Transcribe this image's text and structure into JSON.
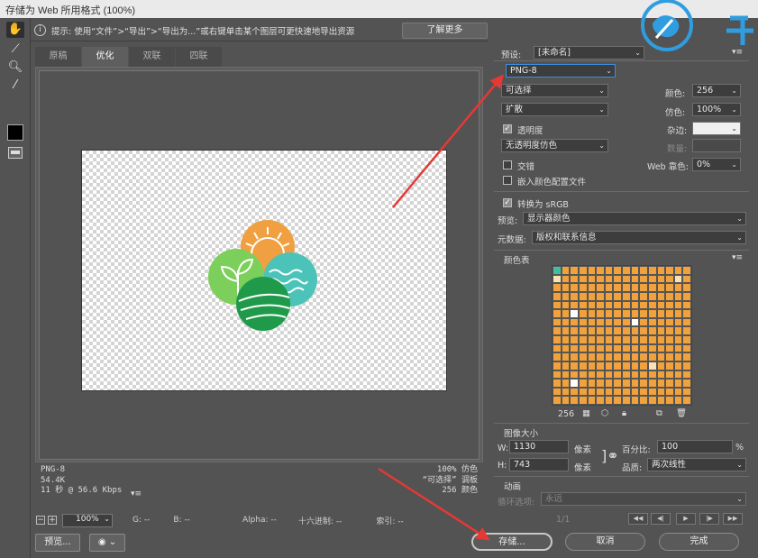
{
  "window": {
    "title": "存储为 Web 所用格式 (100%)"
  },
  "hint": {
    "icon": "info-icon",
    "text": "提示: 使用“文件”>“导出”>“导出为...”或右键单击某个图层可更快速地导出资源",
    "learn_more_label": "了解更多"
  },
  "tools": [
    "hand-tool-icon",
    "slice-select-icon",
    "zoom-icon",
    "eyedropper-icon"
  ],
  "tabs": [
    {
      "label": "原稿",
      "active": false
    },
    {
      "label": "优化",
      "active": true
    },
    {
      "label": "双联",
      "active": false
    },
    {
      "label": "四联",
      "active": false
    }
  ],
  "preview_status": {
    "format": "PNG-8",
    "size": "54.4K",
    "time": "11 秒 @ 56.6 Kbps",
    "dither": "100% 仿色",
    "palette_mode": "“可选择” 调板",
    "colors": "256 颜色"
  },
  "bottom_bar": {
    "zoom": "100%",
    "g": "G: --",
    "b": "B: --",
    "alpha": "Alpha: --",
    "hex": "十六进制: --",
    "index": "索引: --"
  },
  "buttons": {
    "preview": "预览...",
    "save": "存储...",
    "cancel": "取消",
    "done": "完成"
  },
  "settings": {
    "preset_label": "预设:",
    "preset_value": "[未命名]",
    "format": "PNG-8",
    "reduction": "可选择",
    "dither_algo": "扩散",
    "transparency_label": "透明度",
    "transparency_checked": true,
    "transparency_dither": "无透明度仿色",
    "interlaced_label": "交错",
    "interlaced_checked": false,
    "embed_profile_label": "嵌入颜色配置文件",
    "embed_profile_checked": false,
    "colors_label": "颜色:",
    "colors_value": "256",
    "dither_label": "仿色:",
    "dither_value": "100%",
    "matte_label": "杂边:",
    "amount_label": "数量:",
    "web_snap_label": "Web 靠色:",
    "web_snap_value": "0%",
    "convert_srgb_label": "转换为 sRGB",
    "convert_srgb_checked": true,
    "preview_label": "预览:",
    "preview_value": "显示器颜色",
    "metadata_label": "元数据:",
    "metadata_value": "版权和联系信息"
  },
  "color_table": {
    "title": "颜色表",
    "count": "256"
  },
  "image_size": {
    "title": "图像大小",
    "w_label": "W:",
    "w_value": "1130",
    "h_label": "H:",
    "h_value": "743",
    "unit": "像素",
    "percent_label": "百分比:",
    "percent_value": "100",
    "percent_unit": "%",
    "quality_label": "品质:",
    "quality_value": "两次线性"
  },
  "animation": {
    "title": "动画",
    "loop_label": "循环选项:",
    "loop_value": "永远",
    "frame": "1/1"
  },
  "colors": {
    "logo_orange": "#f0a040",
    "logo_lightgreen": "#7ccf5a",
    "logo_teal": "#4cc3b8",
    "logo_darkgreen": "#1f9a4a",
    "arrow_red": "#e53935",
    "watermark_blue": "#2f9de0"
  }
}
